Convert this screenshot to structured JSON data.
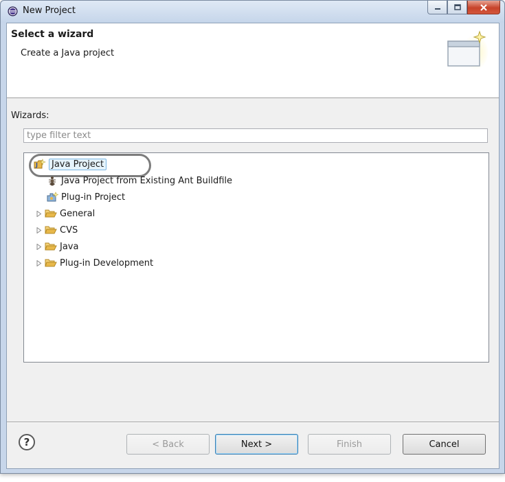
{
  "window": {
    "title": "New Project"
  },
  "header": {
    "title": "Select a wizard",
    "description": "Create a Java project"
  },
  "wizards": {
    "label": "Wizards:",
    "filter_placeholder": "type filter text",
    "items": [
      {
        "label": "Java Project",
        "icon": "java-project-icon",
        "selected": true,
        "expandable": false
      },
      {
        "label": "Java Project from Existing Ant Buildfile",
        "icon": "ant-buildfile-icon",
        "selected": false,
        "expandable": false
      },
      {
        "label": "Plug-in Project",
        "icon": "plugin-project-icon",
        "selected": false,
        "expandable": false
      },
      {
        "label": "General",
        "icon": "folder-icon",
        "selected": false,
        "expandable": true
      },
      {
        "label": "CVS",
        "icon": "folder-icon",
        "selected": false,
        "expandable": true
      },
      {
        "label": "Java",
        "icon": "folder-icon",
        "selected": false,
        "expandable": true
      },
      {
        "label": "Plug-in Development",
        "icon": "folder-icon",
        "selected": false,
        "expandable": true
      }
    ]
  },
  "footer": {
    "help": "?",
    "back": "< Back",
    "next": "Next >",
    "finish": "Finish",
    "cancel": "Cancel"
  },
  "colors": {
    "folder": "#e8b84a",
    "selection_border": "#7ab6e4",
    "selection_fill": "#e5f3fb",
    "close_button": "#c7432a"
  }
}
